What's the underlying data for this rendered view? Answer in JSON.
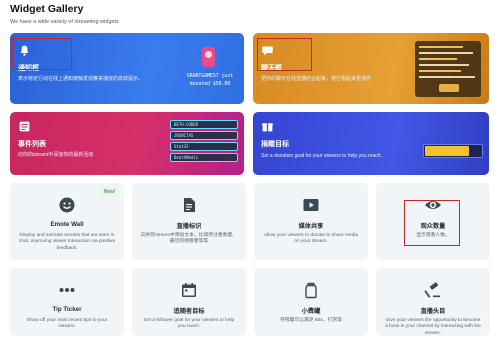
{
  "page": {
    "title": "Widget Gallery",
    "subtitle": "We have a wide variety of streaming widgets"
  },
  "banners": [
    {
      "title": "通知框",
      "desc": "表示特定行动在线上通知被触发观察来播放的高效提示。",
      "icon": "bell-icon",
      "color": "#2f6fe0"
    },
    {
      "title": "聊天框",
      "desc": "把你的聊天在线直播结合起来，使它看起来更漂亮",
      "icon": "chat-bubble-icon",
      "color": "#e0932a"
    },
    {
      "title": "事件列表",
      "desc": "向你的stream中添加你的最新活动",
      "icon": "list-icon",
      "color": "#d6306b"
    },
    {
      "title": "捐赠目标",
      "desc": "Set a donation goal for your viewers to help you reach.",
      "icon": "gift-icon",
      "color": "#3b4fd8"
    }
  ],
  "alert_preview": {
    "text_line1": "GRANTGAMES7 just",
    "text_line2": "donated $50.00"
  },
  "event_preview": {
    "rows": [
      "BETH-CODER",
      "JRUNITAS",
      "Stat33",
      "DeathMedic"
    ]
  },
  "tiles": [
    {
      "title": "Emote Wall",
      "desc": "Display and animate emotes that are seen in chat, improving viewer interaction via positive feedback.",
      "icon": "smiley-icon",
      "badge": "New!"
    },
    {
      "title": "直播标识",
      "desc": "向你的stream中添加文本，比如所注者数量、最近的捐赠者等等",
      "icon": "document-icon"
    },
    {
      "title": "媒体共享",
      "desc": "Allow your viewers to donate to share media on your stream.",
      "icon": "play-icon"
    },
    {
      "title": "观众数量",
      "desc": "显示观看人数。",
      "icon": "eye-icon"
    },
    {
      "title": "Tip Ticker",
      "desc": "Show off your most recent tips to your viewers.",
      "icon": "dots-icon"
    },
    {
      "title": "追随者目标",
      "desc": "Set a follower goal for your viewers to help you reach.",
      "icon": "calendar-icon"
    },
    {
      "title": "小费罐",
      "desc": "存钱罐可以满足 Bits、打赏等",
      "icon": "jar-icon"
    },
    {
      "title": "直播头目",
      "desc": "Give your viewers the opportunity to become a boss in your channel by interacting with the stream.",
      "icon": "gavel-icon"
    }
  ],
  "colors": {
    "highlight": "#c62828",
    "tile_bg": "#f1f5f8",
    "new_badge": "#2e7d32"
  }
}
